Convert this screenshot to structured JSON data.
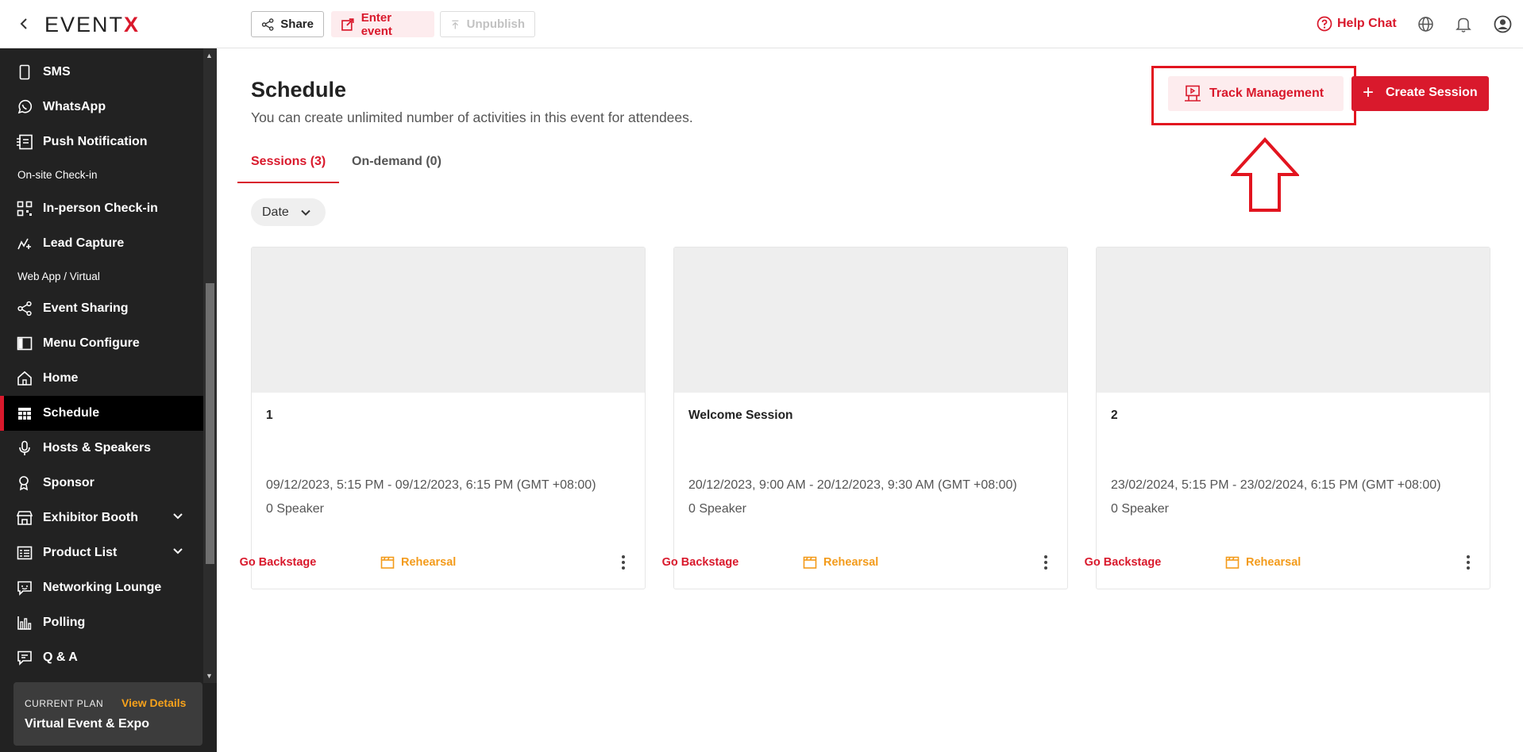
{
  "topbar": {
    "logo": "EVENTX",
    "share_label": "Share",
    "enter_label": "Enter event",
    "unpublish_label": "Unpublish",
    "help_label": "Help Chat"
  },
  "sidebar": {
    "items": [
      {
        "label": "SMS",
        "icon": "phone-icon"
      },
      {
        "label": "WhatsApp",
        "icon": "whatsapp-icon"
      },
      {
        "label": "Push Notification",
        "icon": "push-notification-icon"
      },
      {
        "label": "In-person Check-in",
        "icon": "qr-code-icon"
      },
      {
        "label": "Lead Capture",
        "icon": "lead-capture-icon"
      },
      {
        "label": "Event Sharing",
        "icon": "share-icon"
      },
      {
        "label": "Menu Configure",
        "icon": "layout-icon"
      },
      {
        "label": "Home",
        "icon": "home-icon"
      },
      {
        "label": "Schedule",
        "icon": "schedule-icon"
      },
      {
        "label": "Hosts & Speakers",
        "icon": "microphone-icon"
      },
      {
        "label": "Sponsor",
        "icon": "sponsor-icon"
      },
      {
        "label": "Exhibitor Booth",
        "icon": "booth-icon"
      },
      {
        "label": "Product List",
        "icon": "product-list-icon"
      },
      {
        "label": "Networking Lounge",
        "icon": "chat-icon"
      },
      {
        "label": "Polling",
        "icon": "bar-chart-icon"
      },
      {
        "label": "Q & A",
        "icon": "qa-icon"
      }
    ],
    "sections": [
      "On-site Check-in",
      "Web App / Virtual"
    ],
    "active": "Schedule",
    "plan": {
      "current_label": "CURRENT PLAN",
      "view_details": "View Details",
      "name": "Virtual Event & Expo"
    }
  },
  "main": {
    "title": "Schedule",
    "subtitle": "You can create unlimited number of activities in this event for attendees.",
    "tabs": [
      {
        "label": "Sessions (3)"
      },
      {
        "label": "On-demand (0)"
      }
    ],
    "date_filter": "Date",
    "track_management": "Track Management",
    "create_session": "Create Session",
    "cards": [
      {
        "name": "1",
        "time": "09/12/2023, 5:15 PM - 09/12/2023, 6:15 PM (GMT +08:00)",
        "speakers": "0 Speaker",
        "backstage": "Go Backstage",
        "rehearsal": "Rehearsal"
      },
      {
        "name": "Welcome Session",
        "time": "20/12/2023, 9:00 AM - 20/12/2023, 9:30 AM (GMT +08:00)",
        "speakers": "0 Speaker",
        "backstage": "Go Backstage",
        "rehearsal": "Rehearsal"
      },
      {
        "name": "2",
        "time": "23/02/2024, 5:15 PM - 23/02/2024, 6:15 PM (GMT +08:00)",
        "speakers": "0 Speaker",
        "backstage": "Go Backstage",
        "rehearsal": "Rehearsal"
      }
    ]
  },
  "colors": {
    "accent": "#d9192c",
    "rehearsal": "#f39b1b",
    "sidebar_bg": "#222222"
  }
}
